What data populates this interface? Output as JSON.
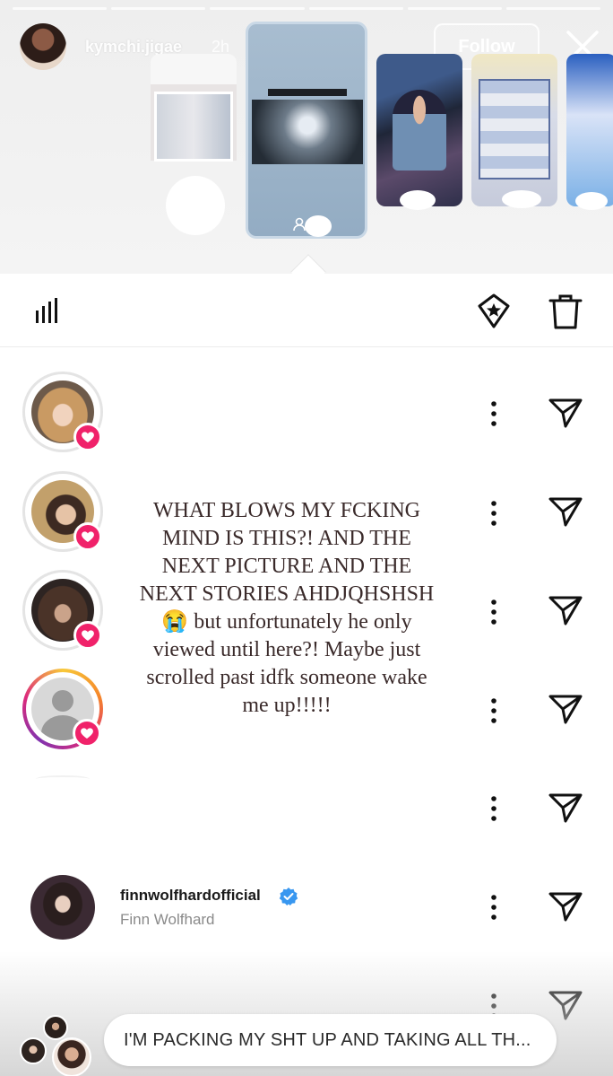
{
  "story_header": {
    "username": "kymchi.jigae",
    "time": "2h",
    "follow_label": "Follow",
    "progress_segments": 6
  },
  "icons": {
    "close": "close-icon",
    "stats": "bar-chart-icon",
    "highlight": "highlight-star-icon",
    "delete": "trash-icon",
    "more": "more-vertical-icon",
    "send": "send-icon",
    "heart": "heart-icon",
    "verified": "verified-badge-icon"
  },
  "viewers": {
    "featured": {
      "username": "finnwolfhardofficial",
      "full_name": "Finn Wolfhard",
      "verified": true
    }
  },
  "overlay_text": "WHAT BLOWS MY FCKING MIND IS THIS?! AND THE NEXT PICTURE AND THE NEXT STORIES AHDJQHSHSH 😭 but unfortunately he only viewed until here?! Maybe just scrolled past idfk someone wake me up!!!!!",
  "reply": {
    "text": "I'M PACKING MY SHT UP AND TAKING ALL TH..."
  },
  "colors": {
    "heart_badge": "#f0226a",
    "verified": "#3897f0",
    "overlay_text": "#3a2a2a"
  }
}
